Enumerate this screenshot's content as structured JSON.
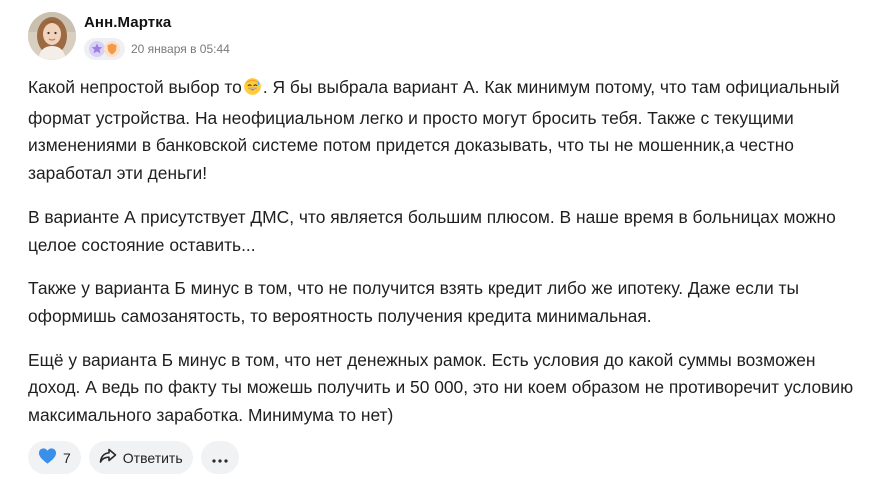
{
  "comment": {
    "author": "Анн.Мартка",
    "date": "20 января в 05:44",
    "paragraphs": [
      {
        "before_emoji": "Какой непростой выбор то",
        "emoji": "smiling-face-with-sweat-emoji",
        "after_emoji": ". Я бы выбрала вариант А. Как минимум потому, что там официальный формат устройства. На неофициальном легко и просто могут бросить тебя. Также с текущими изменениями в банковской системе потом придется доказывать, что ты не мошенник,а честно заработал эти деньги!"
      },
      {
        "text": "В варианте А присутствует ДМС, что является большим плюсом. В наше время в больницах можно целое состояние оставить..."
      },
      {
        "text": "Также у варианта Б минус в том, что не получится взять кредит либо же ипотеку. Даже если ты оформишь самозанятость, то вероятность получения кредита минимальная."
      },
      {
        "text": "Ещё у варианта Б минус в том, что нет денежных рамок. Есть условия до какой суммы возможен доход. А ведь по факту ты можешь получить и 50 000, это ни коем образом не противоречит условию максимального заработка. Минимума то нет)"
      }
    ]
  },
  "badges": [
    {
      "icon": "star-badge-icon",
      "color": "#a48be6"
    },
    {
      "icon": "shield-badge-icon",
      "color": "#f29a4a"
    }
  ],
  "actions": {
    "like_count": "7",
    "like_icon": "heart-icon",
    "like_color": "#3b8fe8",
    "reply_label": "Ответить",
    "reply_icon": "share-arrow-icon",
    "more_icon": "more-dots-icon"
  }
}
